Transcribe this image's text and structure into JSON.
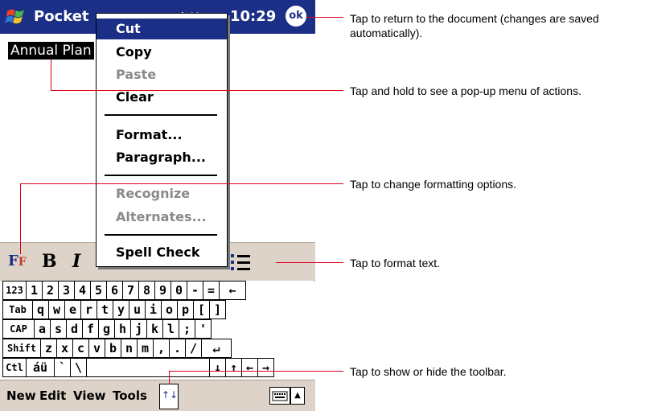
{
  "title_bar": {
    "app_title": "Pocket",
    "status_icons": "⇄ ✕",
    "clock": "10:29",
    "ok_label": "ok"
  },
  "document": {
    "text": "Annual Plan"
  },
  "context_menu": {
    "items": [
      "Cut",
      "Copy",
      "Paste",
      "Clear",
      "Format...",
      "Paragraph...",
      "Recognize",
      "Alternates...",
      "Spell Check"
    ],
    "selected": "Cut",
    "disabled": [
      "Paste",
      "Recognize",
      "Alternates..."
    ]
  },
  "toolbar": {
    "format_icon": "F",
    "bold": "B",
    "italic": "I"
  },
  "keyboard": {
    "row1": [
      "123",
      "1",
      "2",
      "3",
      "4",
      "5",
      "6",
      "7",
      "8",
      "9",
      "0",
      "-",
      "=",
      "←"
    ],
    "row2": [
      "Tab",
      "q",
      "w",
      "e",
      "r",
      "t",
      "y",
      "u",
      "i",
      "o",
      "p",
      "[",
      "]"
    ],
    "row3": [
      "CAP",
      "a",
      "s",
      "d",
      "f",
      "g",
      "h",
      "j",
      "k",
      "l",
      ";",
      "'"
    ],
    "row4": [
      "Shift",
      "z",
      "x",
      "c",
      "v",
      "b",
      "n",
      "m",
      ",",
      ".",
      "/",
      "↵"
    ],
    "row5": [
      "Ctl",
      "áü",
      "`",
      "\\",
      "",
      "↓",
      "↑",
      "←",
      "→"
    ]
  },
  "menu_bar": {
    "items": [
      "New",
      "Edit",
      "View",
      "Tools"
    ],
    "toolbar_toggle": "↑↓"
  },
  "callouts": [
    "Tap to return to the document (changes are saved automatically).",
    "Tap and hold to see a pop-up menu of actions.",
    "Tap to change formatting options.",
    "Tap to format text.",
    "Tap to show or hide the toolbar."
  ]
}
